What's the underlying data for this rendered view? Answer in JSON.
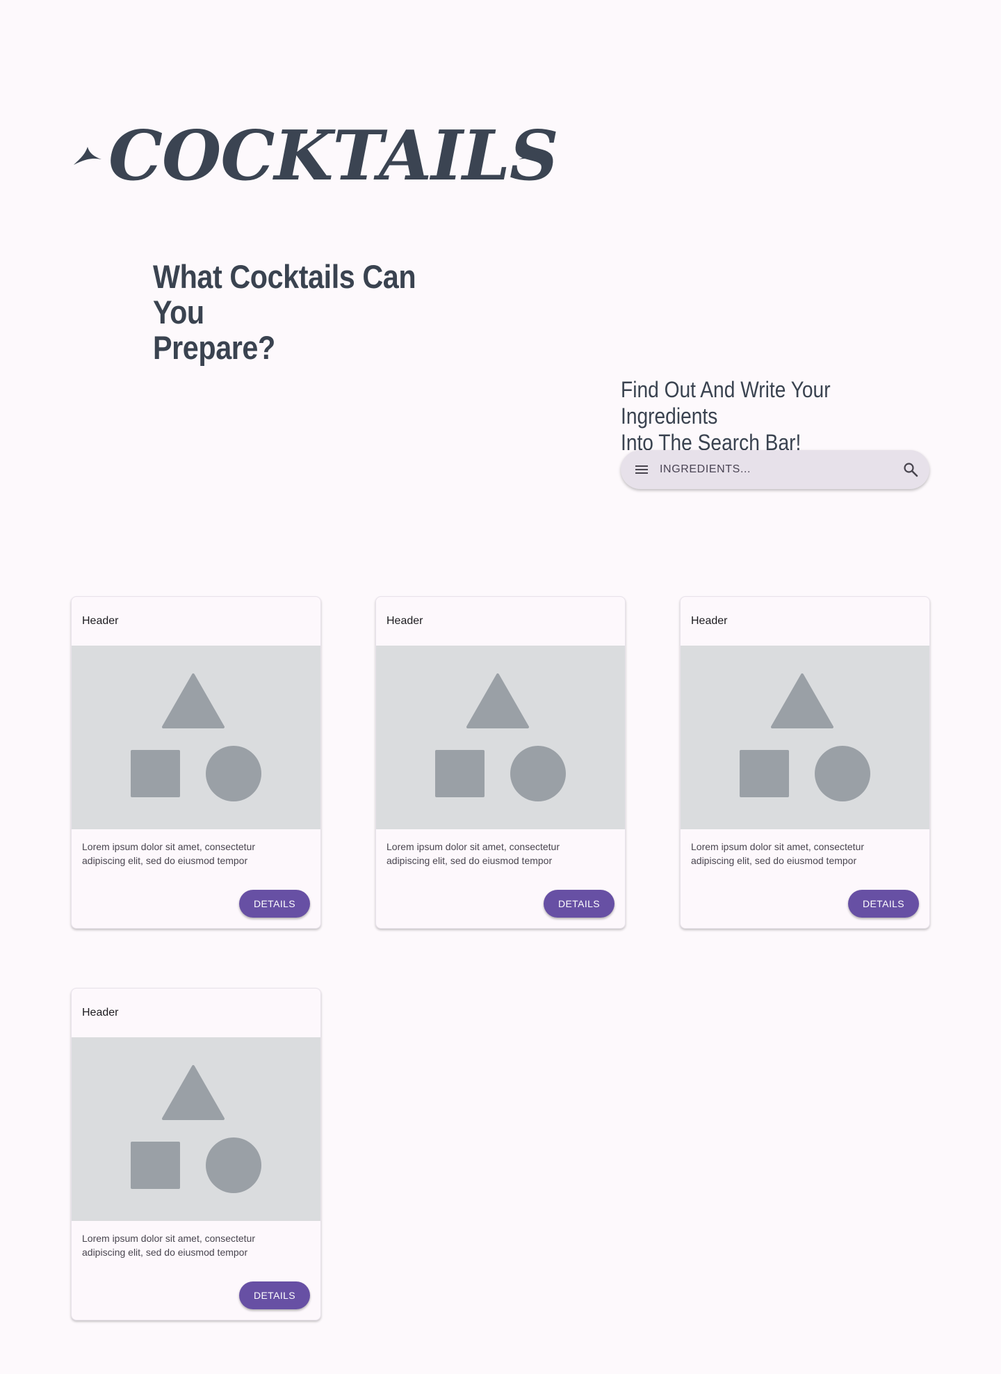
{
  "brand": {
    "logo_text": "COCKTAILS"
  },
  "hero": {
    "headline_line1": "What Cocktails Can You",
    "headline_line2": "Prepare?"
  },
  "search": {
    "prompt_line1": "Find Out And Write Your Ingredients",
    "prompt_line2": "Into The Search Bar!",
    "placeholder": "INGREDIENTS...",
    "value": ""
  },
  "cards": [
    {
      "header": "Header",
      "body_line1": "Lorem ipsum dolor sit amet, consectetur",
      "body_line2": "adipiscing elit, sed do eiusmod tempor",
      "button_label": "DETAILS"
    },
    {
      "header": "Header",
      "body_line1": "Lorem ipsum dolor sit amet, consectetur",
      "body_line2": "adipiscing elit, sed do eiusmod tempor",
      "button_label": "DETAILS"
    },
    {
      "header": "Header",
      "body_line1": "Lorem ipsum dolor sit amet, consectetur",
      "body_line2": "adipiscing elit, sed do eiusmod tempor",
      "button_label": "DETAILS"
    },
    {
      "header": "Header",
      "body_line1": "Lorem ipsum dolor sit amet, consectetur",
      "body_line2": "adipiscing elit, sed do eiusmod tempor",
      "button_label": "DETAILS"
    }
  ],
  "icons": {
    "menu": "menu-icon",
    "search": "search-icon",
    "media_placeholder": "image-placeholder-icon"
  },
  "colors": {
    "page_background": "#fdf9fc",
    "text_primary": "#3a4350",
    "search_background": "#e7e1ea",
    "button_primary": "#6750a4",
    "media_background": "#dadcde",
    "placeholder_shapes": "#9aa0a6"
  }
}
